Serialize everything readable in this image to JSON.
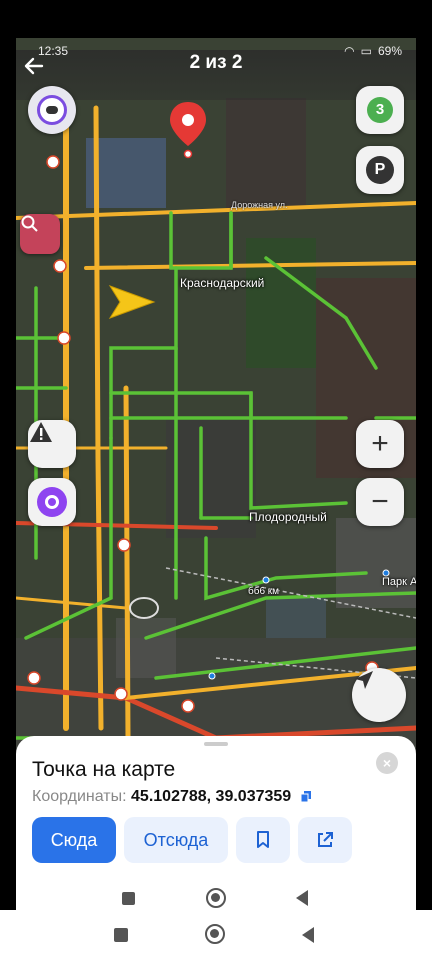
{
  "status_bar": {
    "time": "12:35",
    "battery": "69%"
  },
  "header": {
    "title": "2 из 2"
  },
  "map": {
    "labels": {
      "krasnodarsky": "Краснодарский",
      "plodorodny": "Плодородный",
      "km": "бб6 км",
      "park": "Парк А",
      "street": "Дорожная ул."
    },
    "layers_count": "3",
    "parking_label": "P",
    "zoom_in": "+",
    "zoom_out": "−"
  },
  "sheet": {
    "title": "Точка на карте",
    "coords_label": "Координаты:",
    "coords_value": "45.102788, 39.037359",
    "btn_here": "Сюда",
    "btn_from": "Отсюда",
    "close": "×"
  },
  "colors": {
    "accent": "#2a73e8",
    "pin": "#e53935",
    "arrow": "#f5c518",
    "traffic_green": "#5bc236",
    "traffic_yellow": "#f2b12c",
    "traffic_red": "#d9482b"
  }
}
